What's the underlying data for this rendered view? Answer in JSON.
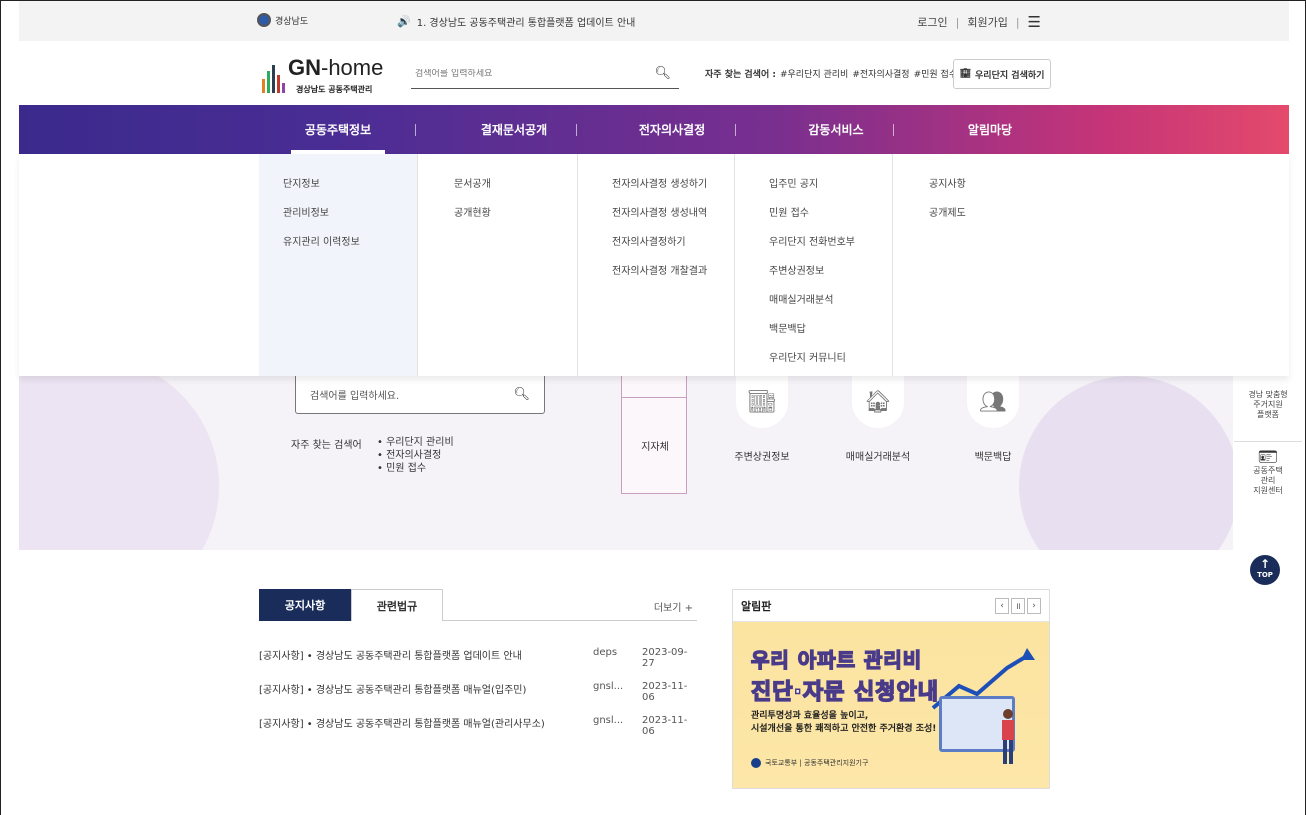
{
  "topbar": {
    "brand": "경상남도",
    "notice": "1. 경상남도 공동주택관리 통합플랫폼 업데이트 안내",
    "login": "로그인",
    "signup": "회원가입"
  },
  "header": {
    "logo_main": "GN",
    "logo_rest": "-home",
    "logo_sub": "경상남도 공동주택관리",
    "search_placeholder": "검색어를 입력하세요",
    "freq_label": "자주 찾는 검색어 :",
    "freq_terms": [
      "#우리단지 관리비",
      "#전자의사결정",
      "#민원 접수"
    ],
    "my_complex_btn": "우리단지 검색하기"
  },
  "gnb": {
    "menus": [
      "공동주택정보",
      "결재문서공개",
      "전자의사결정",
      "감동서비스",
      "알림마당"
    ]
  },
  "dropdown": {
    "col1": [
      "단지정보",
      "관리비정보",
      "유지관리 이력정보"
    ],
    "col2": [
      "문서공개",
      "공개현황"
    ],
    "col3": [
      "전자의사결정 생성하기",
      "전자의사결정 생성내역",
      "전자의사결정하기",
      "전자의사결정 개찰결과"
    ],
    "col4": [
      "입주민 공지",
      "민원 접수",
      "우리단지 전화번호부",
      "주변상권정보",
      "매매실거래분석",
      "백문백답",
      "우리단지 커뮤니티"
    ],
    "col5": [
      "공지사항",
      "공개제도"
    ]
  },
  "hero": {
    "search_placeholder": "검색어를 입력하세요.",
    "freq_label": "자주 찾는 검색어",
    "freq_terms": [
      "• 우리단지 관리비",
      "• 전자의사결정",
      "• 민원 접수"
    ],
    "region_label": "지자체",
    "services": [
      "주변상권정보",
      "매매실거래분석",
      "백문백답"
    ]
  },
  "quick": {
    "q1": [
      "경남 맞춤형",
      "주거지원",
      "플랫폼"
    ],
    "q2": [
      "공동주택",
      "관리",
      "지원센터"
    ],
    "top": "TOP"
  },
  "board": {
    "tab_on": "공지사항",
    "tab_off": "관련법규",
    "more": "더보기 +",
    "rows": [
      {
        "title": "[공지사항]  • 경상남도 공동주택관리 통합플랫폼 업데이트 안내",
        "writer": "deps",
        "date": "2023-09-27"
      },
      {
        "title": "[공지사항]  • 경상남도 공동주택관리 통합플랫폼 매뉴얼(입주민)",
        "writer": "gnsl...",
        "date": "2023-11-06"
      },
      {
        "title": "[공지사항]  • 경상남도 공동주택관리 통합플랫폼 매뉴얼(관리사무소)",
        "writer": "gnsl...",
        "date": "2023-11-06"
      }
    ]
  },
  "alert": {
    "title": "알림판",
    "banner_line1": "우리 아파트 관리비",
    "banner_line2": "진단·자문 신청안내",
    "banner_desc1": "관리투명성과 효율성을 높이고,",
    "banner_desc2": "시설개선을 통한 쾌적하고 안전한 주거환경 조성!",
    "banner_foot": "국토교통부 | 공동주택관리지원기구"
  }
}
